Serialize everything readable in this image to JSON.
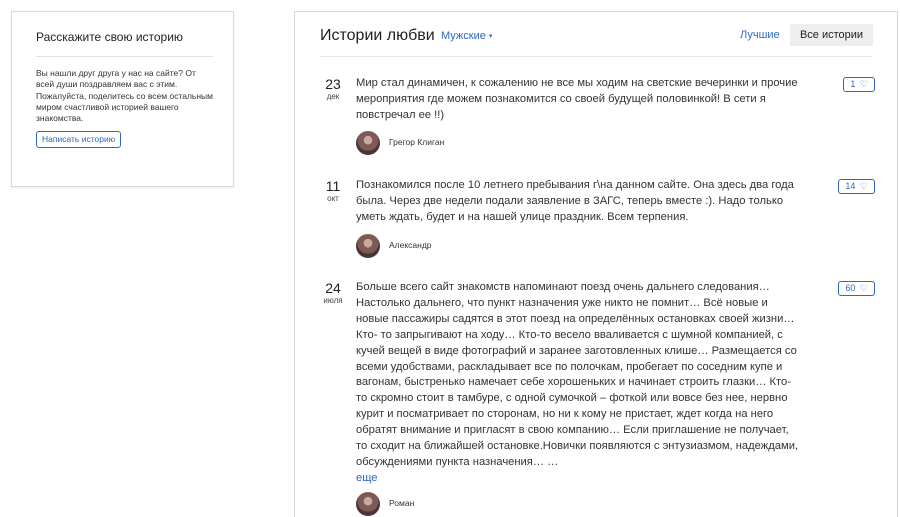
{
  "sidebar": {
    "title": "Расскажите свою историю",
    "text": "Вы нашли друг друга у нас на сайте? От всей души поздравляем вас с этим. Пожалуйста, поделитесь со всем остальным миром счастливой историей вашего знакомства.",
    "button_label": "Написать историю"
  },
  "header": {
    "title": "Истории любви",
    "filter_label": "Мужские",
    "filter_caret": "▾",
    "best_label": "Лучшие",
    "all_label": "Все истории"
  },
  "stories": [
    {
      "day": "23",
      "month": "дек",
      "text": "Мир стал динамичен, к сожалению не все мы ходим на светские вечеринки и прочие мероприятия где можем познакомится со своей будущей половинкой! В сети я повстречал ее !!)",
      "likes": "1",
      "author": "Грегор Клиган"
    },
    {
      "day": "11",
      "month": "окт",
      "text": "Познакомился после 10 летнего пребывания г\\на данном сайте. Она здесь два года была. Через две недели подали заявление в ЗАГС, теперь вместе :). Надо только уметь ждать, будет и на нашей улице праздник. Всем терпения.",
      "likes": "14",
      "author": "Александр"
    },
    {
      "day": "24",
      "month": "июля",
      "text": "Больше всего сайт знакомств напоминают поезд очень дальнего следования… Настолько дальнего, что пункт назначения уже никто не помнит… Всё новые и новые пассажиры садятся в этот поезд на определённых остановках своей жизни… Кто- то запрыгивают на ходу… Кто-то весело вваливается с шумной компанией, с кучей вещей в виде фотографий и заранее заготовленных клише… Размещается со всеми удобствами, раскладывает все по полочкам, пробегает по соседним купе и вагонам, быстренько намечает себе хорошеньких и начинает строить глазки… Кто-то скромно стоит в тамбуре, с одной сумочкой – фоткой или вовсе без нее, нервно курит и посматривает по сторонам, но ни к кому не пристает, ждет когда на него обратят внимание и пригласят в свою компанию… Если приглашение не получает, то сходит на ближайшей остановке.Новички появляются с энтузиазмом, надеждами, обсуждениями пункта назначения… …",
      "more_label": "еще",
      "likes": "60",
      "author": "Роман"
    }
  ],
  "heart_glyph": "♡",
  "colors": {
    "accent": "#2d68c4",
    "border": "#d9d9d9",
    "tab_bg": "#eeeeee"
  }
}
